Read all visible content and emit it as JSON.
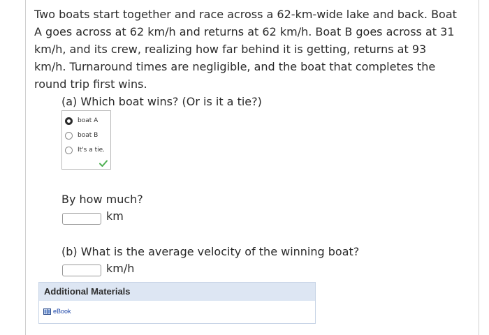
{
  "problem": {
    "text": "Two boats start together and race across a 62-km-wide lake and back. Boat A goes across at 62 km/h and returns at 62 km/h. Boat B goes across at 31 km/h, and its crew, realizing how far behind it is getting, returns at 93 km/h. Turnaround times are negligible, and the boat that completes the round trip first wins."
  },
  "part_a": {
    "question": "(a) Which boat wins? (Or is it a tie?)",
    "options": [
      {
        "label": "boat A",
        "selected": true
      },
      {
        "label": "boat B",
        "selected": false
      },
      {
        "label": "It's a tie.",
        "selected": false
      }
    ],
    "correct_icon": "checkmark-icon",
    "follow_up": "By how much?",
    "follow_up_unit": "km",
    "follow_up_value": ""
  },
  "part_b": {
    "question": "(b) What is the average velocity of the winning boat?",
    "unit": "km/h",
    "value": ""
  },
  "materials": {
    "header": "Additional Materials",
    "link_label": "eBook",
    "link_icon": "book-icon"
  },
  "colors": {
    "check_green": "#4caf50",
    "materials_header_bg": "#dde6f3",
    "link": "#1a44a8"
  }
}
